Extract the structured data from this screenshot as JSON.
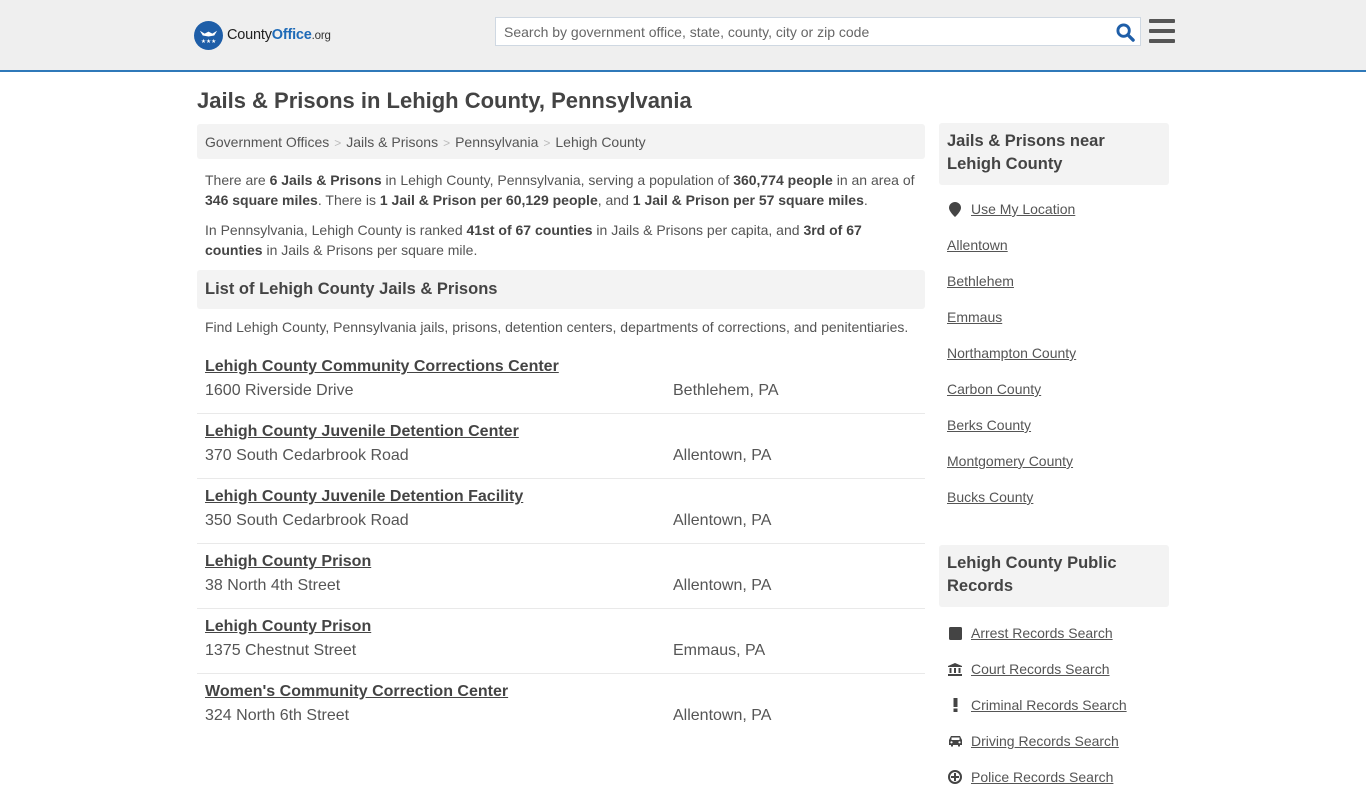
{
  "header": {
    "logo": {
      "part1": "County",
      "part2": "Office",
      "part3": ".org",
      "icon": "eagle-stars-logo-icon"
    },
    "search": {
      "placeholder": "Search by government office, state, county, city or zip code",
      "value": "",
      "icon": "search-icon"
    },
    "menu_icon": "hamburger-menu-icon"
  },
  "colors": {
    "brand_blue": "#1e6ab7",
    "header_border": "#2f79b9",
    "panel_gray": "#f3f3f3",
    "header_bg": "#efefef"
  },
  "page": {
    "title": "Jails & Prisons in Lehigh County, Pennsylvania"
  },
  "breadcrumb": [
    {
      "label": "Government Offices"
    },
    {
      "label": "Jails & Prisons"
    },
    {
      "label": "Pennsylvania"
    },
    {
      "label": "Lehigh County"
    }
  ],
  "breadcrumb_separator": ">",
  "intro": {
    "p1": {
      "t1": "There are ",
      "b1": "6 Jails & Prisons",
      "t2": " in Lehigh County, Pennsylvania, serving a population of ",
      "b2": "360,774 people",
      "t3": " in an area of ",
      "b3": "346 square miles",
      "t4": ". There is ",
      "b4": "1 Jail & Prison per 60,129 people",
      "t5": ", and ",
      "b5": "1 Jail & Prison per 57 square miles",
      "t6": "."
    },
    "p2": {
      "t1": "In Pennsylvania, Lehigh County is ranked ",
      "b1": "41st of 67 counties",
      "t2": " in Jails & Prisons per capita, and ",
      "b2": "3rd of 67 counties",
      "t3": " in Jails & Prisons per square mile."
    }
  },
  "list_section": {
    "heading": "List of Lehigh County Jails & Prisons",
    "description": "Find Lehigh County, Pennsylvania jails, prisons, detention centers, departments of corrections, and penitentiaries.",
    "items": [
      {
        "name": "Lehigh County Community Corrections Center",
        "address": "1600 Riverside Drive",
        "city": "Bethlehem, PA"
      },
      {
        "name": "Lehigh County Juvenile Detention Center",
        "address": "370 South Cedarbrook Road",
        "city": "Allentown, PA"
      },
      {
        "name": "Lehigh County Juvenile Detention Facility",
        "address": "350 South Cedarbrook Road",
        "city": "Allentown, PA"
      },
      {
        "name": "Lehigh County Prison",
        "address": "38 North 4th Street",
        "city": "Allentown, PA"
      },
      {
        "name": "Lehigh County Prison",
        "address": "1375 Chestnut Street",
        "city": "Emmaus, PA"
      },
      {
        "name": "Women's Community Correction Center",
        "address": "324 North 6th Street",
        "city": "Allentown, PA"
      }
    ]
  },
  "sidebar": {
    "nearby": {
      "heading": "Jails & Prisons near Lehigh County",
      "location_link": {
        "label": "Use My Location",
        "icon": "map-pin-icon"
      },
      "links": [
        {
          "label": "Allentown"
        },
        {
          "label": "Bethlehem"
        },
        {
          "label": "Emmaus"
        },
        {
          "label": "Northampton County"
        },
        {
          "label": "Carbon County"
        },
        {
          "label": "Berks County"
        },
        {
          "label": "Montgomery County"
        },
        {
          "label": "Bucks County"
        }
      ]
    },
    "records": {
      "heading": "Lehigh County Public Records",
      "links": [
        {
          "label": "Arrest Records Search",
          "icon": "square-icon"
        },
        {
          "label": "Court Records Search",
          "icon": "courthouse-icon"
        },
        {
          "label": "Criminal Records Search",
          "icon": "exclamation-icon"
        },
        {
          "label": "Driving Records Search",
          "icon": "car-icon"
        },
        {
          "label": "Police Records Search",
          "icon": "police-badge-icon"
        }
      ]
    }
  }
}
